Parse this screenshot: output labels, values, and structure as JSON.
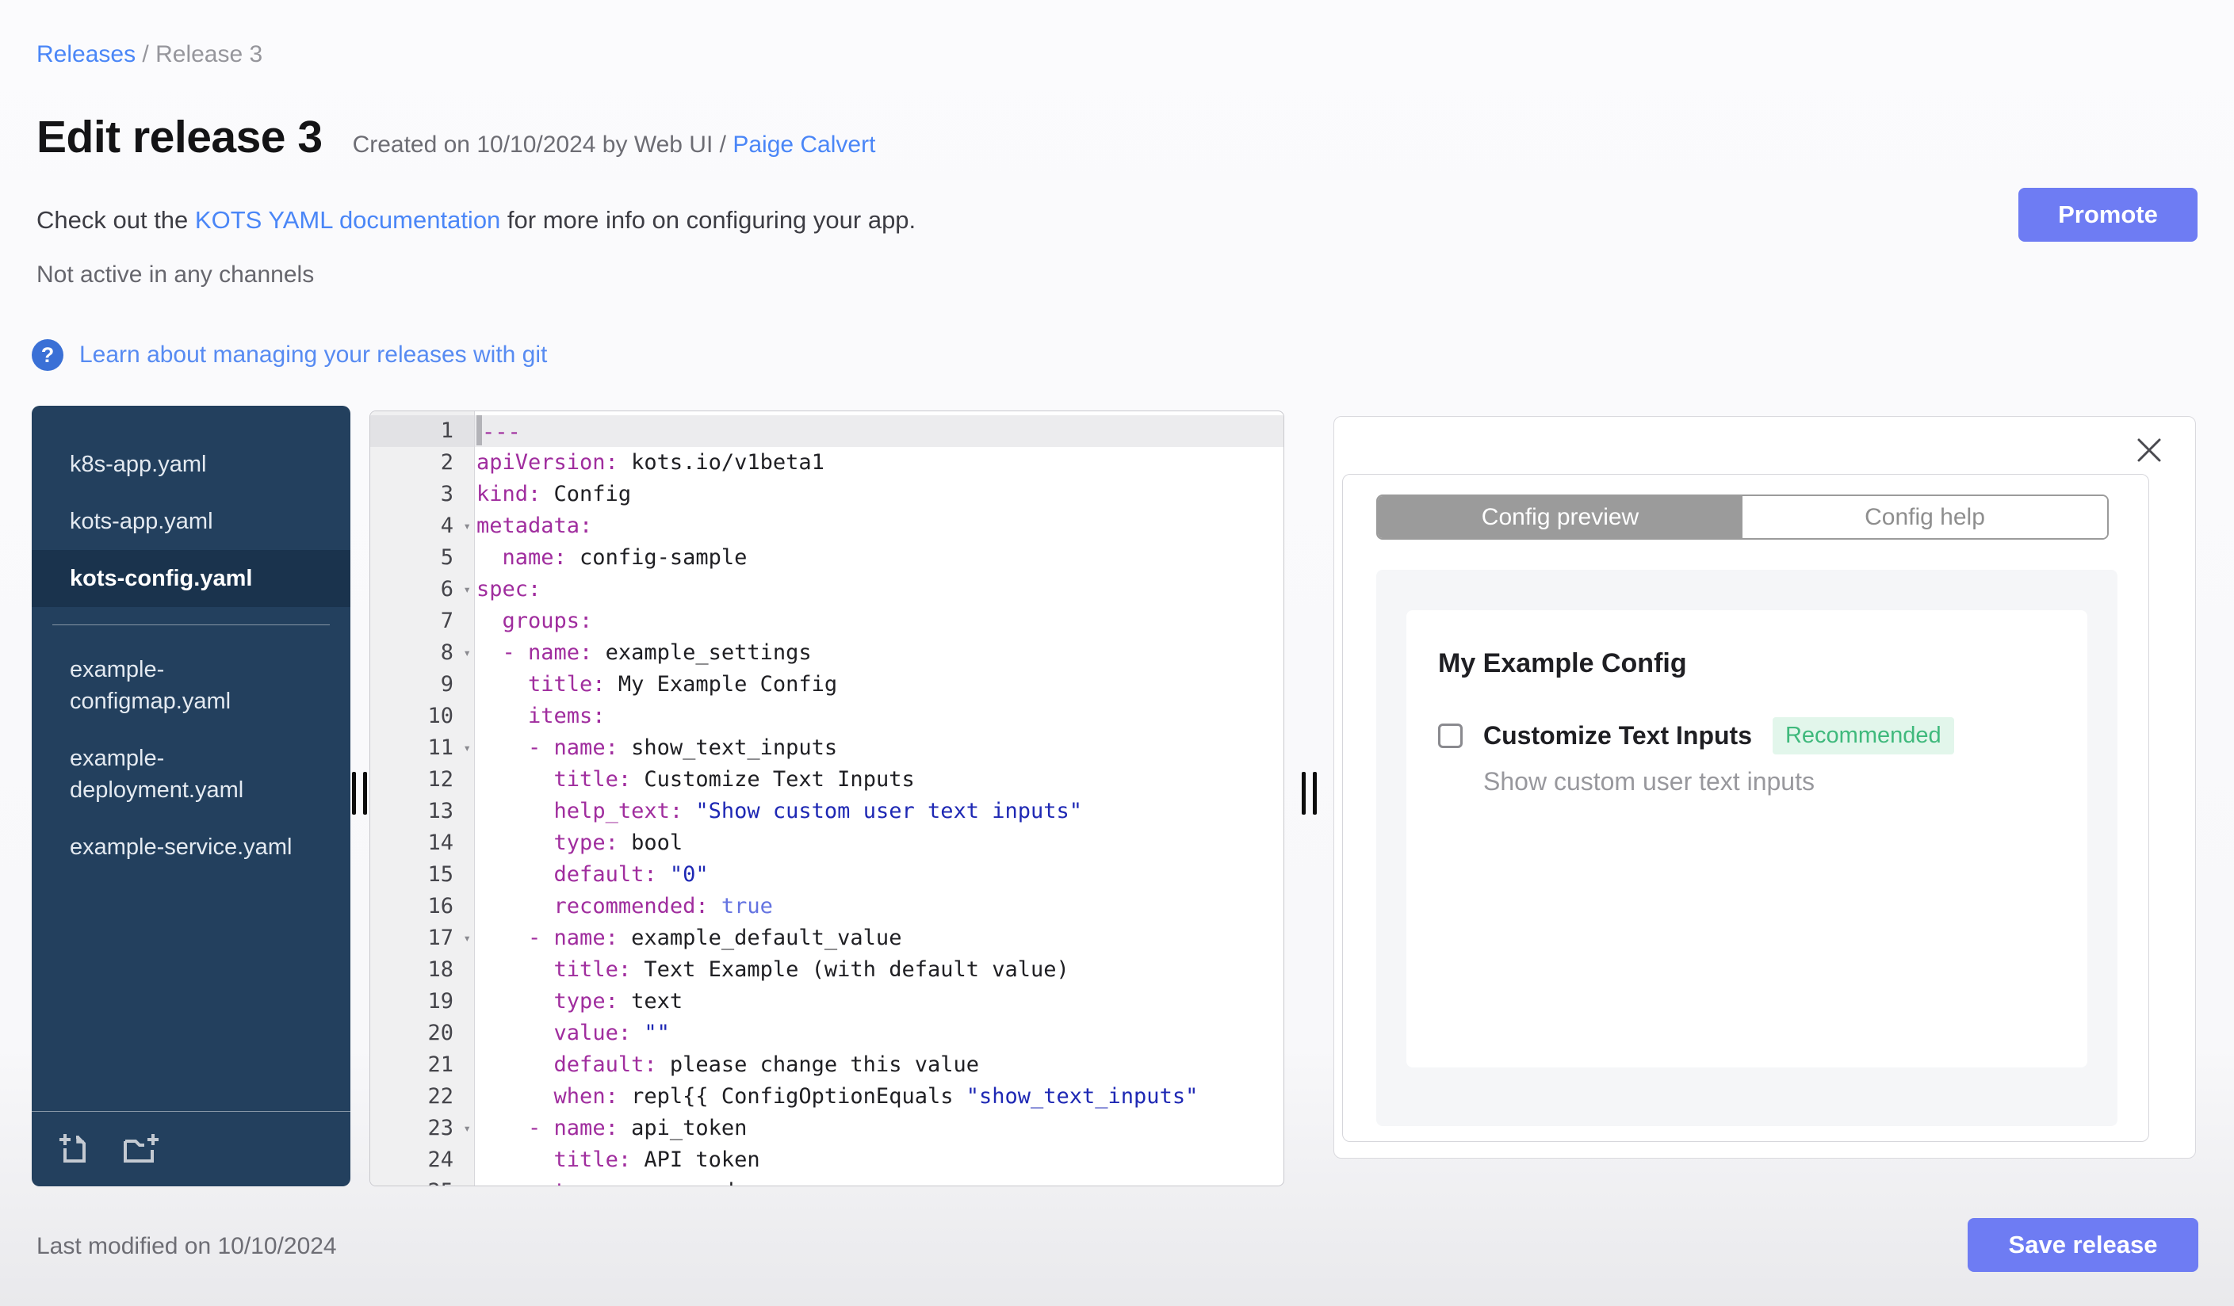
{
  "breadcrumb": {
    "link": "Releases",
    "separator": " / ",
    "current": "Release 3"
  },
  "header": {
    "title": "Edit release 3",
    "created_prefix": "Created on 10/10/2024 by Web UI / ",
    "created_author": "Paige Calvert",
    "doc_before": "Check out the ",
    "doc_link": "KOTS YAML documentation",
    "doc_after": " for more info on configuring your app.",
    "channel_status": "Not active in any channels",
    "promote_label": "Promote"
  },
  "git_banner": {
    "icon_glyph": "?",
    "label": "Learn about managing your releases with git"
  },
  "file_sidebar": {
    "groups": [
      [
        "k8s-app.yaml",
        "kots-app.yaml",
        "kots-config.yaml"
      ],
      [
        "example-configmap.yaml",
        "example-deployment.yaml",
        "example-service.yaml"
      ]
    ],
    "selected": "kots-config.yaml",
    "footer_icons": [
      "new-file-icon",
      "new-folder-icon"
    ]
  },
  "editor": {
    "lines": [
      {
        "n": 1,
        "active": true,
        "cursor": true,
        "fold": false,
        "seg": [
          [
            "key",
            "---"
          ]
        ]
      },
      {
        "n": 2,
        "fold": false,
        "seg": [
          [
            "key",
            "apiVersion:"
          ],
          [
            "plain",
            " kots.io/v1beta1"
          ]
        ]
      },
      {
        "n": 3,
        "fold": false,
        "seg": [
          [
            "key",
            "kind:"
          ],
          [
            "plain",
            " Config"
          ]
        ]
      },
      {
        "n": 4,
        "fold": true,
        "seg": [
          [
            "key",
            "metadata:"
          ]
        ]
      },
      {
        "n": 5,
        "fold": false,
        "seg": [
          [
            "plain",
            "  "
          ],
          [
            "key",
            "name:"
          ],
          [
            "plain",
            " config-sample"
          ]
        ]
      },
      {
        "n": 6,
        "fold": true,
        "seg": [
          [
            "key",
            "spec:"
          ]
        ]
      },
      {
        "n": 7,
        "fold": false,
        "seg": [
          [
            "plain",
            "  "
          ],
          [
            "key",
            "groups:"
          ]
        ]
      },
      {
        "n": 8,
        "fold": true,
        "seg": [
          [
            "plain",
            "  "
          ],
          [
            "dash",
            "- "
          ],
          [
            "key",
            "name:"
          ],
          [
            "plain",
            " example_settings"
          ]
        ]
      },
      {
        "n": 9,
        "fold": false,
        "seg": [
          [
            "plain",
            "    "
          ],
          [
            "key",
            "title:"
          ],
          [
            "plain",
            " My Example Config"
          ]
        ]
      },
      {
        "n": 10,
        "fold": false,
        "seg": [
          [
            "plain",
            "    "
          ],
          [
            "key",
            "items:"
          ]
        ]
      },
      {
        "n": 11,
        "fold": true,
        "seg": [
          [
            "plain",
            "    "
          ],
          [
            "dash",
            "- "
          ],
          [
            "key",
            "name:"
          ],
          [
            "plain",
            " show_text_inputs"
          ]
        ]
      },
      {
        "n": 12,
        "fold": false,
        "seg": [
          [
            "plain",
            "      "
          ],
          [
            "key",
            "title:"
          ],
          [
            "plain",
            " Customize Text Inputs"
          ]
        ]
      },
      {
        "n": 13,
        "fold": false,
        "seg": [
          [
            "plain",
            "      "
          ],
          [
            "key",
            "help_text:"
          ],
          [
            "plain",
            " "
          ],
          [
            "str",
            "\"Show custom user text inputs\""
          ]
        ]
      },
      {
        "n": 14,
        "fold": false,
        "seg": [
          [
            "plain",
            "      "
          ],
          [
            "key",
            "type:"
          ],
          [
            "plain",
            " bool"
          ]
        ]
      },
      {
        "n": 15,
        "fold": false,
        "seg": [
          [
            "plain",
            "      "
          ],
          [
            "key",
            "default:"
          ],
          [
            "plain",
            " "
          ],
          [
            "str",
            "\"0\""
          ]
        ]
      },
      {
        "n": 16,
        "fold": false,
        "seg": [
          [
            "plain",
            "      "
          ],
          [
            "key",
            "recommended:"
          ],
          [
            "plain",
            " "
          ],
          [
            "bool",
            "true"
          ]
        ]
      },
      {
        "n": 17,
        "fold": true,
        "seg": [
          [
            "plain",
            "    "
          ],
          [
            "dash",
            "- "
          ],
          [
            "key",
            "name:"
          ],
          [
            "plain",
            " example_default_value"
          ]
        ]
      },
      {
        "n": 18,
        "fold": false,
        "seg": [
          [
            "plain",
            "      "
          ],
          [
            "key",
            "title:"
          ],
          [
            "plain",
            " Text Example (with default value)"
          ]
        ]
      },
      {
        "n": 19,
        "fold": false,
        "seg": [
          [
            "plain",
            "      "
          ],
          [
            "key",
            "type:"
          ],
          [
            "plain",
            " text"
          ]
        ]
      },
      {
        "n": 20,
        "fold": false,
        "seg": [
          [
            "plain",
            "      "
          ],
          [
            "key",
            "value:"
          ],
          [
            "plain",
            " "
          ],
          [
            "str",
            "\"\""
          ]
        ]
      },
      {
        "n": 21,
        "fold": false,
        "seg": [
          [
            "plain",
            "      "
          ],
          [
            "key",
            "default:"
          ],
          [
            "plain",
            " please change this value"
          ]
        ]
      },
      {
        "n": 22,
        "fold": false,
        "seg": [
          [
            "plain",
            "      "
          ],
          [
            "key",
            "when:"
          ],
          [
            "plain",
            " repl{{ ConfigOptionEquals "
          ],
          [
            "str",
            "\"show_text_inputs\""
          ]
        ]
      },
      {
        "n": 23,
        "fold": true,
        "seg": [
          [
            "plain",
            "    "
          ],
          [
            "dash",
            "- "
          ],
          [
            "key",
            "name:"
          ],
          [
            "plain",
            " api_token"
          ]
        ]
      },
      {
        "n": 24,
        "fold": false,
        "seg": [
          [
            "plain",
            "      "
          ],
          [
            "key",
            "title:"
          ],
          [
            "plain",
            " API token"
          ]
        ]
      },
      {
        "n": 25,
        "fold": false,
        "seg": [
          [
            "plain",
            "      "
          ],
          [
            "key",
            "type:"
          ],
          [
            "plain",
            " password"
          ]
        ]
      }
    ]
  },
  "preview_panel": {
    "tabs": [
      {
        "label": "Config preview",
        "active": true
      },
      {
        "label": "Config help",
        "active": false
      }
    ],
    "config": {
      "group_title": "My Example Config",
      "item_label": "Customize Text Inputs",
      "badge": "Recommended",
      "help_text": "Show custom user text inputs",
      "checked": false
    }
  },
  "footer": {
    "last_modified": "Last modified on 10/10/2024",
    "save_label": "Save release"
  },
  "colors": {
    "link_blue": "#4a86f7",
    "git_icon_blue": "#3a70d6",
    "button_blue": "#6e7cf3",
    "sidebar_navy": "#23405e",
    "sidebar_selected": "#1a334d",
    "tab_active_gray": "#9b9b9b",
    "badge_text_green": "#3fb97c",
    "badge_bg_green": "#e2f6eb",
    "code_key": "#a02d9e",
    "code_string": "#1e28b4",
    "code_bool": "#6473e1"
  }
}
